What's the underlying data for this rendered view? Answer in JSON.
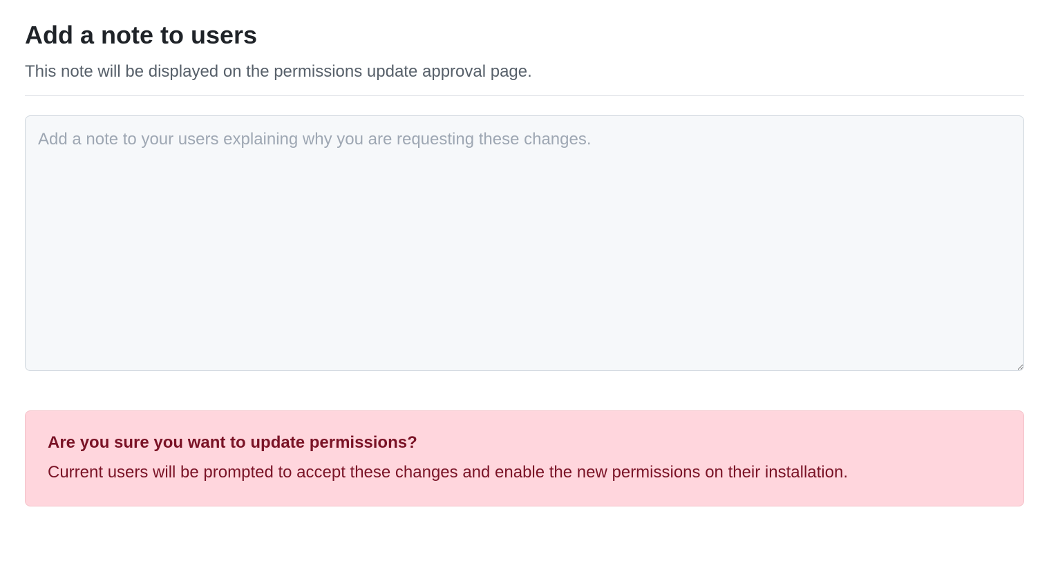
{
  "header": {
    "title": "Add a note to users",
    "subtitle": "This note will be displayed on the permissions update approval page."
  },
  "note": {
    "placeholder": "Add a note to your users explaining why you are requesting these changes.",
    "value": ""
  },
  "warning": {
    "title": "Are you sure you want to update permissions?",
    "text": "Current users will be prompted to accept these changes and enable the new permissions on their installation."
  }
}
